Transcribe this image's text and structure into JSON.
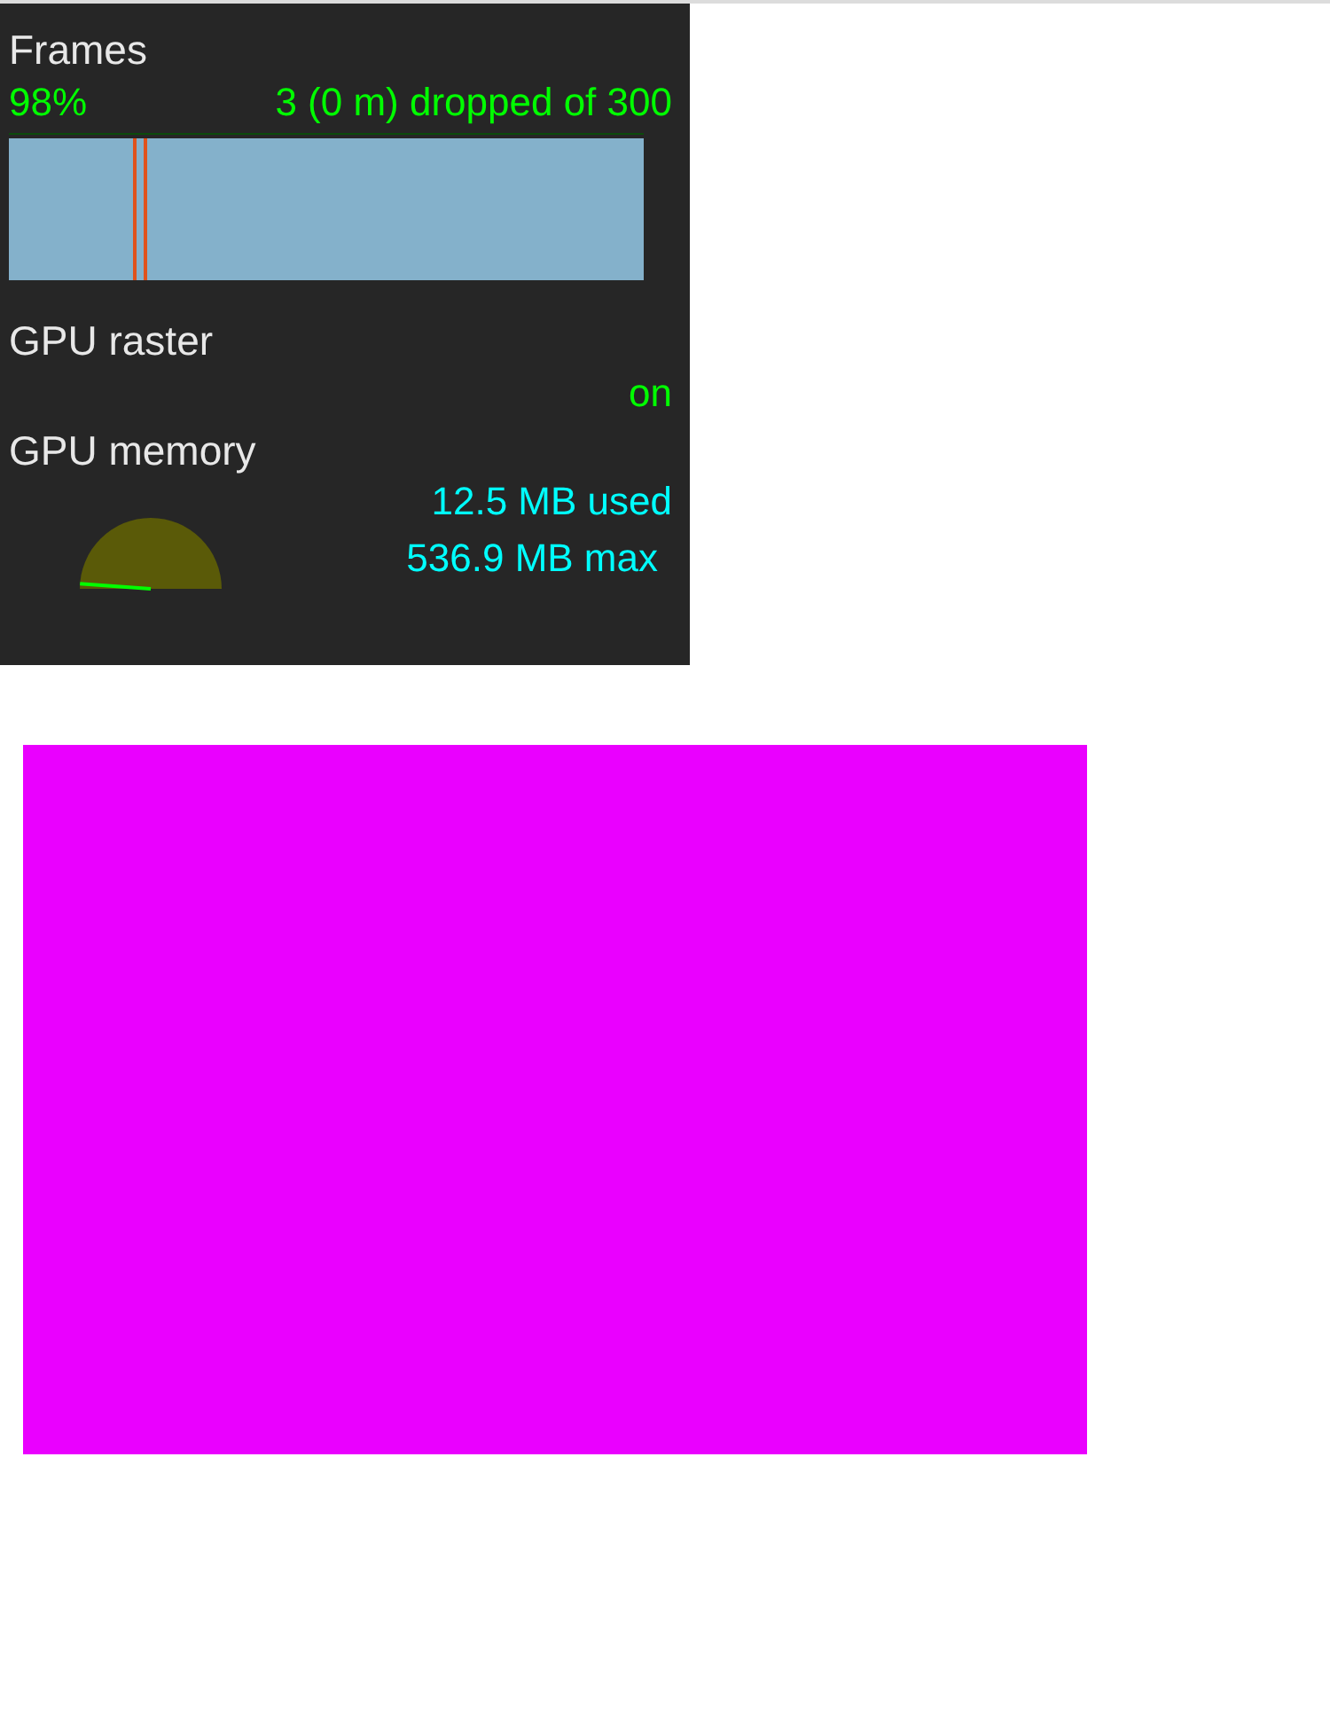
{
  "fps_meter": {
    "frames": {
      "title": "Frames",
      "percent": "98%",
      "dropped": "3 (0 m) dropped of 300"
    },
    "gpu_raster": {
      "title": "GPU raster",
      "status": "on"
    },
    "gpu_memory": {
      "title": "GPU memory",
      "used": "12.5 MB used",
      "max": "536.9 MB max"
    }
  }
}
